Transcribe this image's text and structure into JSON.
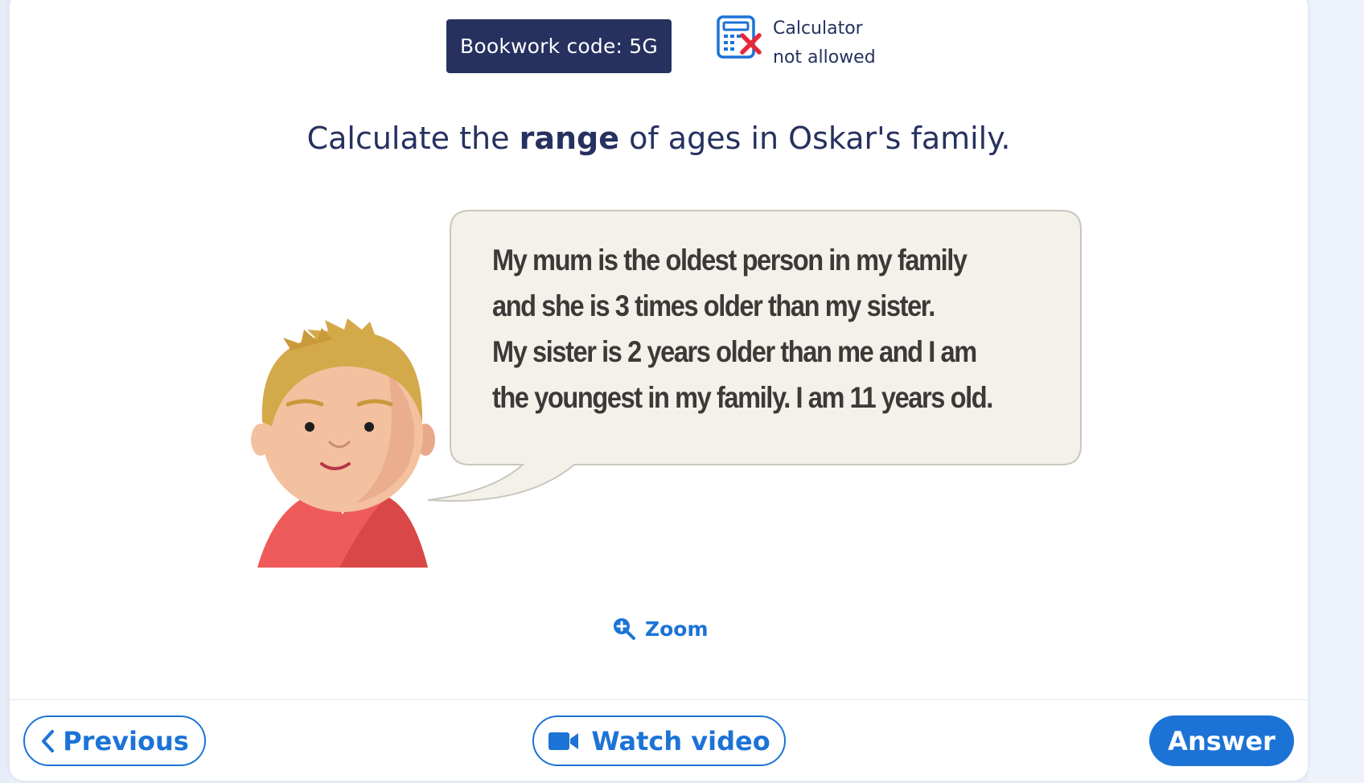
{
  "bookwork": {
    "label": "Bookwork code: 5G"
  },
  "calculator": {
    "icon": "calculator-not-allowed-icon",
    "line1": "Calculator",
    "line2": "not allowed"
  },
  "question": {
    "prefix": "Calculate the ",
    "bold": "range",
    "suffix": " of ages in Oskar's family."
  },
  "speech": {
    "lines": [
      "My mum is the oldest person in my family",
      "and she is 3 times older than my sister.",
      "My sister is 2 years older than me and I am",
      "the youngest in my family. I am 11 years old."
    ]
  },
  "zoom": {
    "label": "Zoom",
    "icon": "zoom-in-icon"
  },
  "footer": {
    "previous_label": "Previous",
    "video_label": "Watch video",
    "answer_label": "Answer"
  },
  "colors": {
    "navy": "#26315f",
    "accent": "#1c73d6",
    "bubble_bg": "#f3f1ea",
    "bubble_border": "#c9c7bc",
    "shirt": "#ef5a5a",
    "hair": "#d4a94a"
  }
}
